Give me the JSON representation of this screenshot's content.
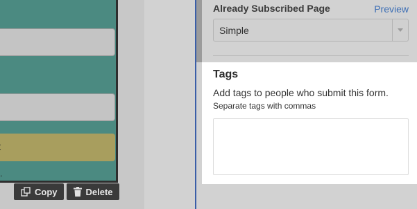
{
  "canvas": {
    "button_text": "t",
    "trailing_text": ".",
    "actions": {
      "copy_label": "Copy",
      "delete_label": "Delete",
      "copy_icon": "copy-icon",
      "delete_icon": "trash-icon"
    }
  },
  "settings": {
    "already_subscribed": {
      "label": "Already Subscribed Page",
      "preview_link": "Preview",
      "selected_value": "Simple",
      "dropdown_icon": "caret-down-icon"
    },
    "tags": {
      "title": "Tags",
      "description": "Add tags to people who submit this form.",
      "help_text": "Separate tags with commas",
      "value": ""
    }
  },
  "colors": {
    "form_background": "#4b8a81",
    "button_background": "#a89e5e",
    "link": "#3d6fb5",
    "panel_accent": "#3a5ea8",
    "action_background": "#3a3a3a"
  }
}
